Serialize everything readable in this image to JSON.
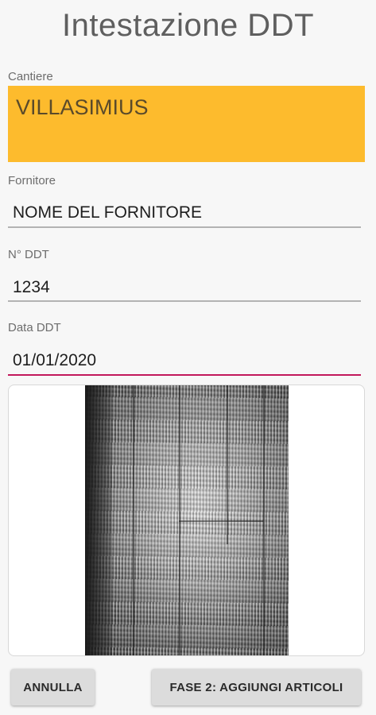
{
  "header": {
    "title": "Intestazione DDT"
  },
  "form": {
    "cantiere": {
      "label": "Cantiere",
      "value": "VILLASIMIUS",
      "background_color": "#fdbb2d"
    },
    "fornitore": {
      "label": "Fornitore",
      "value": "NOME DEL FORNITORE"
    },
    "numero_ddt": {
      "label": "N° DDT",
      "value": "1234"
    },
    "data_ddt": {
      "label": "Data DDT",
      "value": "01/01/2020"
    },
    "accent_color": "#c2185b"
  },
  "actions": {
    "cancel_label": "ANNULLA",
    "next_label": "FASE 2: AGGIUNGI ARTICOLI"
  }
}
